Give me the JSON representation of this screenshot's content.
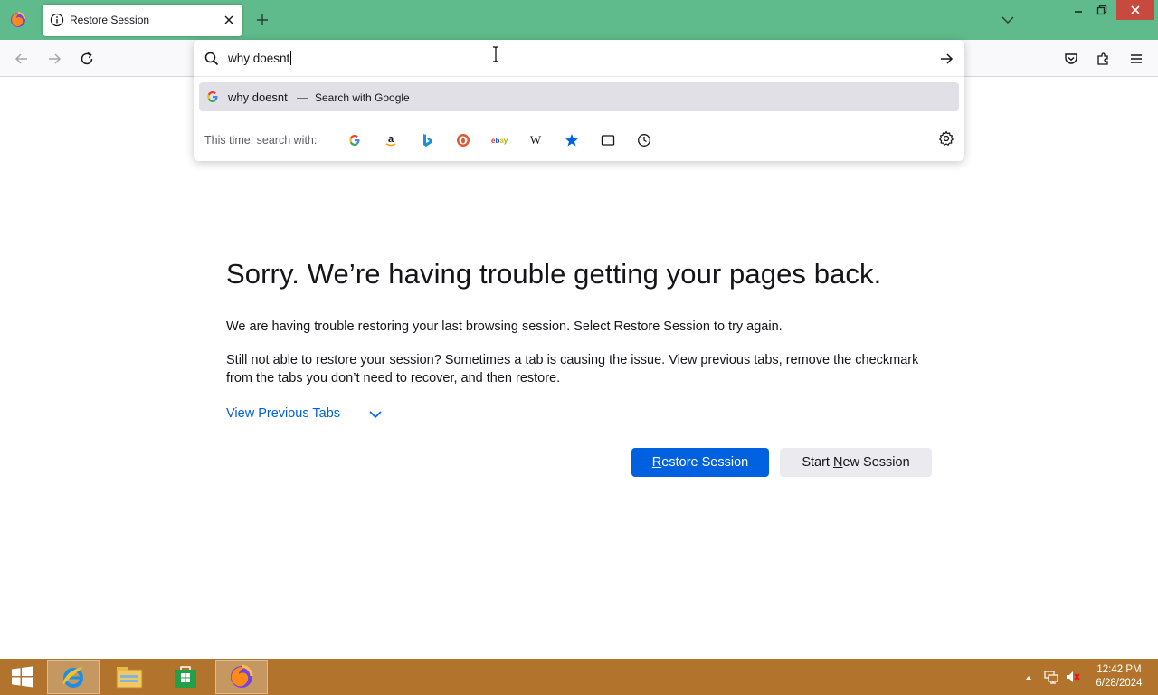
{
  "browser": {
    "tab": {
      "title": "Restore Session"
    },
    "urlbar": {
      "input_value": "why doesnt",
      "suggestion": {
        "text": "why doesnt",
        "separator": "—",
        "action": "Search with Google"
      },
      "oneoff_label": "This time, search with:",
      "oneoff_engines": [
        "google-icon",
        "amazon-icon",
        "bing-icon",
        "duckduckgo-icon",
        "ebay-icon",
        "wikipedia-icon",
        "bookmarks-icon",
        "tabs-icon",
        "history-icon"
      ]
    }
  },
  "page": {
    "title": "Sorry. We’re having trouble getting your pages back.",
    "paragraph1": "We are having trouble restoring your last browsing session. Select Restore Session to try again.",
    "paragraph2": "Still not able to restore your session? Sometimes a tab is causing the issue. View previous tabs, remove the checkmark from the tabs you don’t need to recover, and then restore.",
    "view_tabs_label": "View Previous Tabs",
    "restore_button": {
      "accesskey": "R",
      "rest": "estore Session"
    },
    "new_session_button": {
      "before": "Start ",
      "accesskey": "N",
      "rest": "ew Session"
    }
  },
  "taskbar": {
    "time": "12:42 PM",
    "date": "6/28/2024"
  },
  "colors": {
    "tabbar": "#5fbb8b",
    "taskbar": "#b2742c",
    "accent": "#0061e0"
  }
}
